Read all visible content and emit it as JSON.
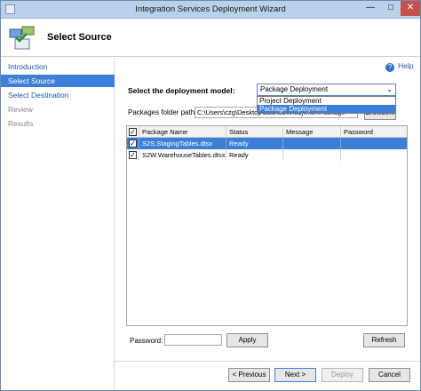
{
  "window": {
    "title": "Integration Services Deployment Wizard",
    "controls": {
      "minimize": "—",
      "maximize": "□",
      "close": "✕"
    }
  },
  "header": {
    "title": "Select Source",
    "icon": "wizard-icon"
  },
  "nav": {
    "items": [
      {
        "label": "Introduction",
        "state": "link"
      },
      {
        "label": "Select Source",
        "state": "active"
      },
      {
        "label": "Select Destination",
        "state": "link"
      },
      {
        "label": "Review",
        "state": "disabled"
      },
      {
        "label": "Results",
        "state": "disabled"
      }
    ]
  },
  "help": {
    "label": "Help",
    "icon": "help-icon"
  },
  "deployment": {
    "model_label": "Select the deployment model:",
    "model_value": "Package Deployment",
    "options": [
      "Project Deployment",
      "Package Deployment"
    ],
    "selected_option_index": 1
  },
  "packages": {
    "folder_label": "Packages folder path:",
    "folder_value": "C:\\Users\\czg\\Desktop\\S2S\\S2W\\obj\\Run\\Package",
    "browse_label": "Browse..."
  },
  "grid": {
    "headers": [
      "Package Name",
      "Status",
      "Message",
      "Password"
    ],
    "rows": [
      {
        "checked": true,
        "name": "S2S.StagingTables.dtsx",
        "status": "Ready",
        "message": "",
        "password": "",
        "selected": true
      },
      {
        "checked": true,
        "name": "S2W.WarehouseTables.dtsx",
        "status": "Ready",
        "message": "",
        "password": "",
        "selected": false
      }
    ]
  },
  "password": {
    "label": "Password:",
    "value": "",
    "apply_label": "Apply",
    "refresh_label": "Refresh"
  },
  "footer": {
    "previous_label": "< Previous",
    "next_label": "Next >",
    "deploy_label": "Deploy",
    "cancel_label": "Cancel"
  }
}
